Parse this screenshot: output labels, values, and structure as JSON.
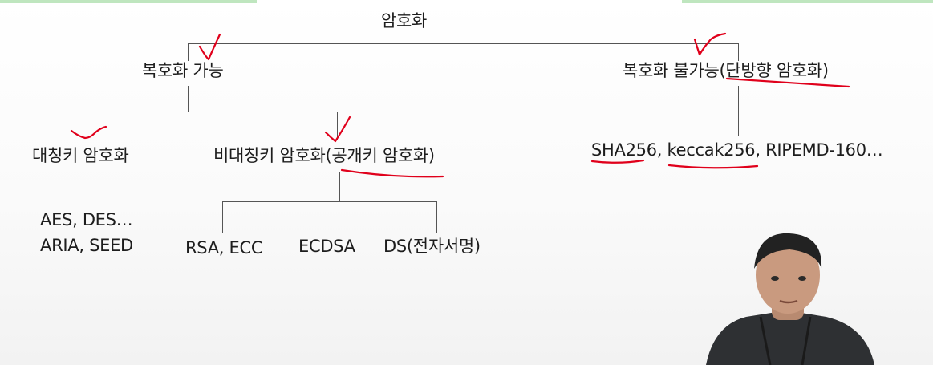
{
  "diagram": {
    "root": "암호화",
    "branch_reversible": "복호화 가능",
    "branch_irreversible": "복호화 불가능(단방향 암호화)",
    "symmetric": "대칭키 암호화",
    "asymmetric": "비대칭키 암호화(공개키 암호화)",
    "symmetric_examples_line1": "AES, DES…",
    "symmetric_examples_line2": "ARIA, SEED",
    "asym_rsa_ecc": "RSA, ECC",
    "asym_ecdsa": "ECDSA",
    "asym_ds": "DS(전자서명)",
    "hash_examples": "SHA256, keccak256, RIPEMD-160…"
  },
  "colors": {
    "annotation": "#e0001b",
    "line": "#555555",
    "presenter_shirt": "#2e3033",
    "presenter_skin": "#c99a7f",
    "presenter_hair": "#222222"
  },
  "presenter": {
    "icon": "person-video-overlay"
  }
}
